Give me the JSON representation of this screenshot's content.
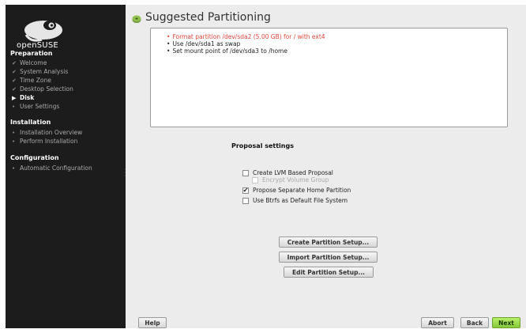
{
  "sidebar": {
    "logo_text": "openSUSE",
    "sections": [
      {
        "heading": "Preparation"
      },
      {
        "heading": "Installation"
      },
      {
        "heading": "Configuration"
      }
    ],
    "items": [
      {
        "label": "Welcome",
        "state": "done"
      },
      {
        "label": "System Analysis",
        "state": "done"
      },
      {
        "label": "Time Zone",
        "state": "done"
      },
      {
        "label": "Desktop Selection",
        "state": "done"
      },
      {
        "label": "Disk",
        "state": "current"
      },
      {
        "label": "User Settings",
        "state": "pending"
      },
      {
        "label": "Installation Overview",
        "state": "pending"
      },
      {
        "label": "Perform Installation",
        "state": "pending"
      },
      {
        "label": "Automatic Configuration",
        "state": "pending"
      }
    ]
  },
  "page": {
    "title": "Suggested Partitioning",
    "title_icon": "disk-icon"
  },
  "summary": {
    "items": [
      {
        "text": "Format partition /dev/sda2 (5.00 GB) for / with ext4",
        "color": "#e0443a"
      },
      {
        "text": "Use /dev/sda1 as swap",
        "color": "#222222"
      },
      {
        "text": "Set mount point of /dev/sda3 to /home",
        "color": "#222222"
      }
    ]
  },
  "proposal": {
    "heading": "Proposal settings",
    "options": [
      {
        "label": "Create LVM Based Proposal",
        "checked": false,
        "enabled": true
      },
      {
        "label": "Encrypt Volume Group",
        "checked": false,
        "enabled": false
      },
      {
        "label": "Propose Separate Home Partition",
        "checked": true,
        "enabled": true
      },
      {
        "label": "Use Btrfs as Default File System",
        "checked": false,
        "enabled": true
      }
    ]
  },
  "actions": {
    "create": "Create Partition Setup...",
    "import": "Import Partition Setup...",
    "edit": "Edit Partition Setup..."
  },
  "footer": {
    "help": "Help",
    "abort": "Abort",
    "back": "Back",
    "next": "Next"
  }
}
